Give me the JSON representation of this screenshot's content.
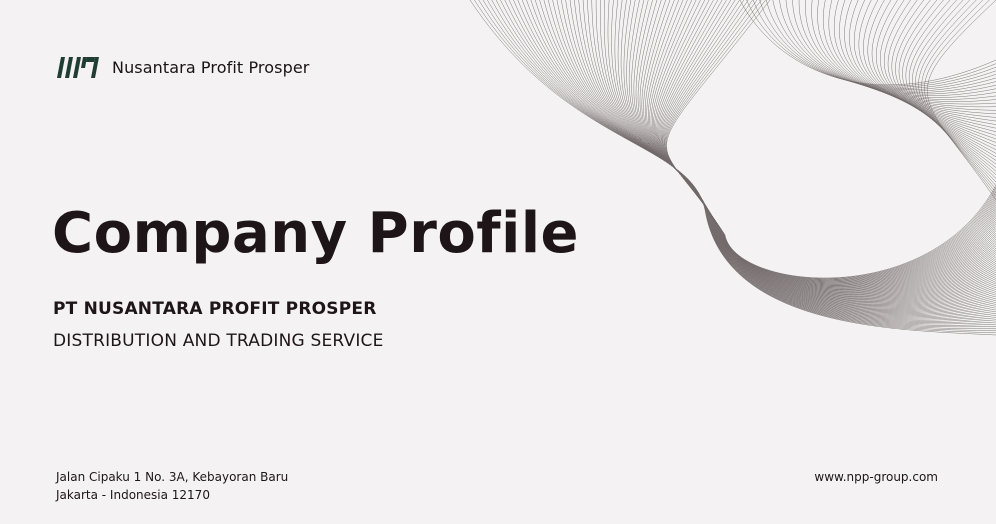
{
  "header": {
    "logo_icon": "npp-logo-icon",
    "company_name": "Nusantara Profit Prosper"
  },
  "main": {
    "title": "Company Profile",
    "subtitle_line1": "PT NUSANTARA PROFIT PROSPER",
    "subtitle_line2": "DISTRIBUTION AND TRADING SERVICE"
  },
  "footer": {
    "address_line1": "Jalan Cipaku 1 No. 3A, Kebayoran Baru",
    "address_line2": "Jakarta - Indonesia 12170",
    "website": "www.npp-group.com"
  },
  "colors": {
    "background": "#f4f2f2",
    "text": "#1e1519",
    "logo_green": "#1f3d33",
    "wave_lines": "#5a5052"
  }
}
